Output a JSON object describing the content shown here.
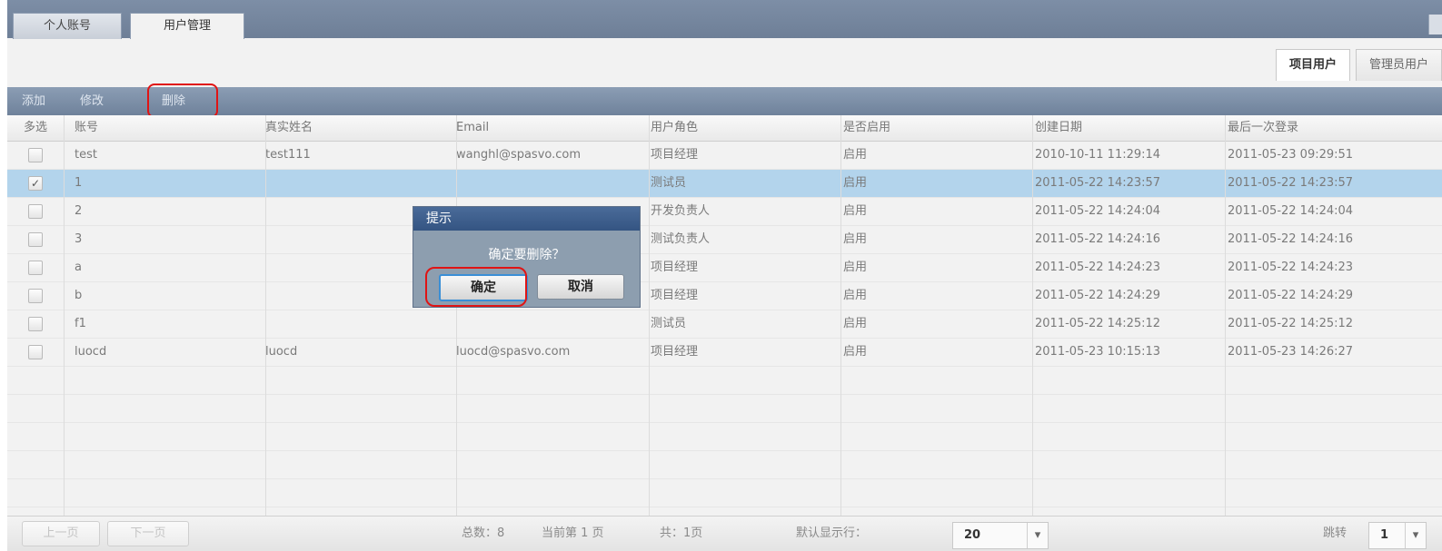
{
  "tabs": {
    "personal": "个人账号",
    "users": "用户管理"
  },
  "subtabs": {
    "project_users": "项目用户",
    "admin_users": "管理员用户"
  },
  "toolbar": {
    "add": "添加",
    "edit": "修改",
    "delete": "删除"
  },
  "table": {
    "headers": [
      "多选",
      "账号",
      "真实姓名",
      "Email",
      "用户角色",
      "是否启用",
      "创建日期",
      "最后一次登录"
    ],
    "rows": [
      {
        "checked": false,
        "selected": false,
        "account": "test",
        "name": "test111",
        "email": "wanghl@spasvo.com",
        "role": "项目经理",
        "enabled": "启用",
        "created": "2010-10-11 11:29:14",
        "last_login": "2011-05-23 09:29:51"
      },
      {
        "checked": true,
        "selected": true,
        "account": "1",
        "name": "",
        "email": "",
        "role": "测试员",
        "enabled": "启用",
        "created": "2011-05-22 14:23:57",
        "last_login": "2011-05-22 14:23:57"
      },
      {
        "checked": false,
        "selected": false,
        "account": "2",
        "name": "",
        "email": "",
        "role": "开发负责人",
        "enabled": "启用",
        "created": "2011-05-22 14:24:04",
        "last_login": "2011-05-22 14:24:04"
      },
      {
        "checked": false,
        "selected": false,
        "account": "3",
        "name": "",
        "email": "",
        "role": "测试负责人",
        "enabled": "启用",
        "created": "2011-05-22 14:24:16",
        "last_login": "2011-05-22 14:24:16"
      },
      {
        "checked": false,
        "selected": false,
        "account": "a",
        "name": "",
        "email": "",
        "role": "项目经理",
        "enabled": "启用",
        "created": "2011-05-22 14:24:23",
        "last_login": "2011-05-22 14:24:23"
      },
      {
        "checked": false,
        "selected": false,
        "account": "b",
        "name": "",
        "email": "",
        "role": "项目经理",
        "enabled": "启用",
        "created": "2011-05-22 14:24:29",
        "last_login": "2011-05-22 14:24:29"
      },
      {
        "checked": false,
        "selected": false,
        "account": "f1",
        "name": "",
        "email": "",
        "role": "测试员",
        "enabled": "启用",
        "created": "2011-05-22 14:25:12",
        "last_login": "2011-05-22 14:25:12"
      },
      {
        "checked": false,
        "selected": false,
        "account": "luocd",
        "name": "luocd",
        "email": "luocd@spasvo.com",
        "role": "项目经理",
        "enabled": "启用",
        "created": "2011-05-23 10:15:13",
        "last_login": "2011-05-23 14:26:27"
      }
    ]
  },
  "pager": {
    "prev": "上一页",
    "next": "下一页",
    "total": "总数：8",
    "current": "当前第 1 页",
    "pages": "共：1页",
    "default_rows_label": "默认显示行：",
    "default_rows_value": "20",
    "jump_label": "跳转",
    "jump_value": "1"
  },
  "dialog": {
    "title": "提示",
    "message": "确定要删除？",
    "ok": "确定",
    "cancel": "取消"
  },
  "colors": {
    "toolbar": "#7b8ea6",
    "selected_row": "#b3d4ec",
    "dialog_title": "#3d5e8e",
    "highlight_ring": "#e01414"
  }
}
